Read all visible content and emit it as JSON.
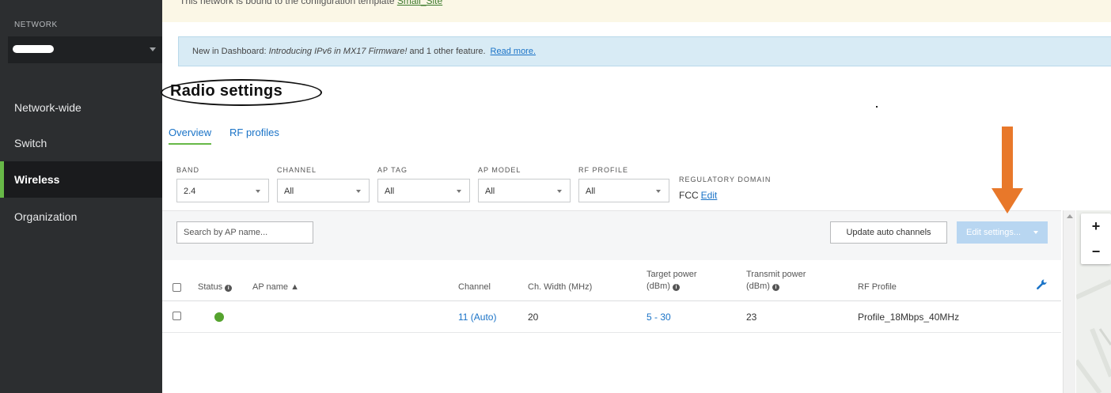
{
  "sidebar": {
    "network_label": "NETWORK",
    "items": [
      {
        "label": "Network-wide"
      },
      {
        "label": "Switch"
      },
      {
        "label": "Wireless"
      },
      {
        "label": "Organization"
      }
    ]
  },
  "template_banner": {
    "text": "This network is bound to the configuration template ",
    "link": "Small_Site"
  },
  "info_banner": {
    "prefix": "New in Dashboard: ",
    "highlight": "Introducing IPv6 in MX17 Firmware!",
    "suffix": " and 1 other feature.",
    "link": "Read more."
  },
  "page": {
    "title": "Radio settings"
  },
  "tabs": [
    {
      "label": "Overview"
    },
    {
      "label": "RF profiles"
    }
  ],
  "filters": {
    "band": {
      "label": "BAND",
      "value": "2.4"
    },
    "channel": {
      "label": "CHANNEL",
      "value": "All"
    },
    "ap_tag": {
      "label": "AP TAG",
      "value": "All"
    },
    "ap_model": {
      "label": "AP MODEL",
      "value": "All"
    },
    "rf_profile": {
      "label": "RF PROFILE",
      "value": "All"
    },
    "regulatory": {
      "label": "REGULATORY DOMAIN",
      "value": "FCC",
      "edit": "Edit"
    }
  },
  "toolbar": {
    "search_placeholder": "Search by AP name...",
    "update_label": "Update auto channels",
    "edit_label": "Edit settings..."
  },
  "table": {
    "headers": {
      "status": "Status",
      "ap_name": "AP name ▲",
      "channel": "Channel",
      "ch_width": "Ch. Width (MHz)",
      "target_power_1": "Target power",
      "target_power_2": "(dBm)",
      "transmit_power_1": "Transmit power",
      "transmit_power_2": "(dBm)",
      "rf_profile": "RF Profile"
    },
    "rows": [
      {
        "status": "online",
        "ap_name": "",
        "channel": "11 (Auto)",
        "ch_width": "20",
        "target_power": "5 - 30",
        "transmit_power": "23",
        "rf_profile": "Profile_18Mbps_40MHz"
      }
    ]
  },
  "map": {
    "zoom_in": "+",
    "zoom_out": "−"
  },
  "colors": {
    "sidebar_bg": "#2c2e30",
    "active_accent": "#67b847",
    "link": "#1a73c7",
    "status_online": "#55a32e",
    "annotation_arrow": "#e8782a"
  },
  "icons": [
    "wrench-icon",
    "info-icon",
    "chevron-down-icon"
  ]
}
